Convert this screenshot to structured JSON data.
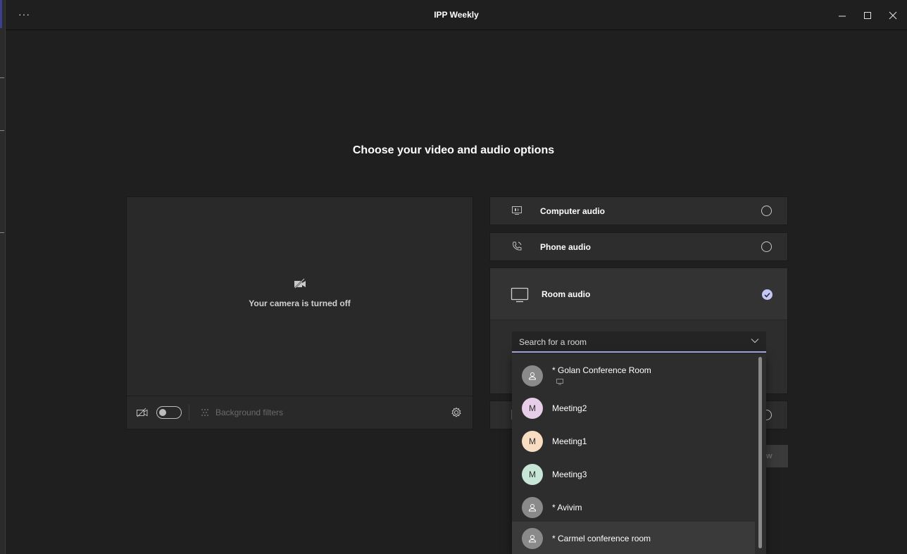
{
  "window": {
    "title": "IPP Weekly",
    "more_label": "···"
  },
  "heading": "Choose your video and audio options",
  "video": {
    "camera_off_text": "Your camera is turned off",
    "background_filters_label": "Background filters",
    "camera_toggle_on": false
  },
  "audio_options": [
    {
      "label": "Computer audio",
      "icon": "computer-audio-icon",
      "selected": false
    },
    {
      "label": "Phone audio",
      "icon": "phone-audio-icon",
      "selected": false
    },
    {
      "label": "Room audio",
      "icon": "room-audio-icon",
      "selected": true
    }
  ],
  "room_search": {
    "placeholder": "Search for a room"
  },
  "rooms": [
    {
      "name": "* Golan Conference Room",
      "avatar": "person",
      "avatar_color": "#8a8a8a",
      "sub_icon": "screen-icon"
    },
    {
      "name": "Meeting2",
      "avatar": "M",
      "avatar_color": "#e8cde8"
    },
    {
      "name": "Meeting1",
      "avatar": "M",
      "avatar_color": "#f8ddc2"
    },
    {
      "name": "Meeting3",
      "avatar": "M",
      "avatar_color": "#c8e6d8"
    },
    {
      "name": "* Avivim",
      "avatar": "person",
      "avatar_color": "#8a8a8a"
    },
    {
      "name": "* Carmel conference room",
      "avatar": "person",
      "avatar_color": "#8a8a8a",
      "highlighted": true
    }
  ],
  "join_button_partial": "w",
  "colors": {
    "background": "#1f1f1f",
    "panel": "#292929",
    "accent": "#a9aae8"
  }
}
